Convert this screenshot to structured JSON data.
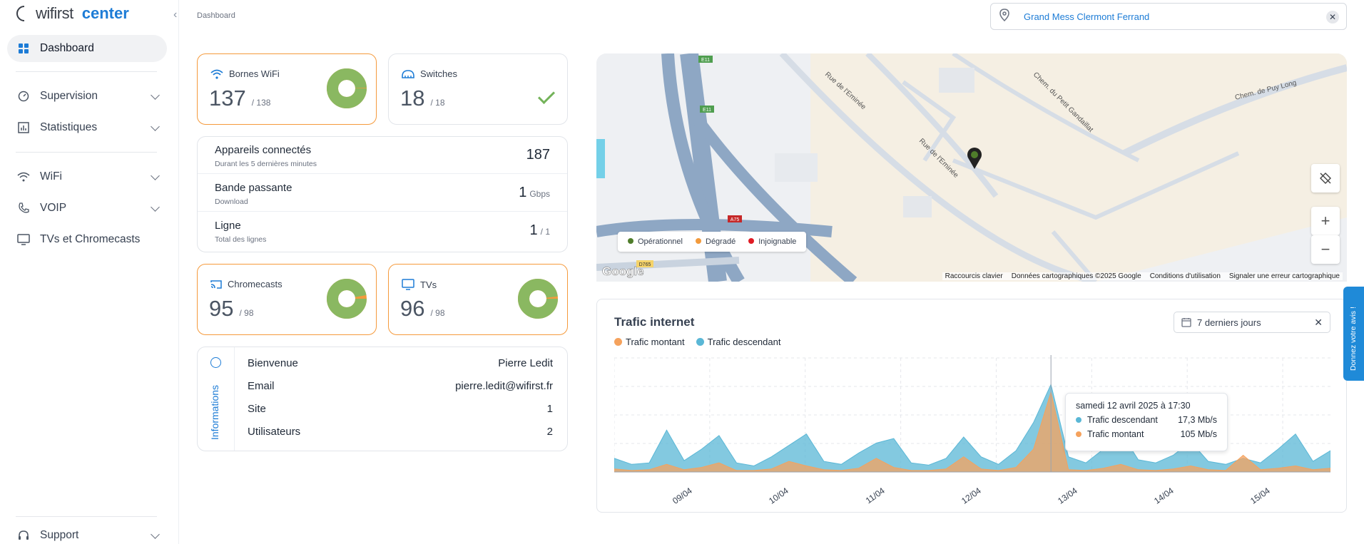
{
  "app": {
    "brand": "wifirst",
    "product": "center"
  },
  "breadcrumb": "Dashboard",
  "site": {
    "value": "Grand Mess Clermont Ferrand"
  },
  "sidebar": {
    "items": [
      {
        "label": "Dashboard",
        "icon": "grid-icon",
        "active": true
      },
      {
        "label": "Supervision",
        "icon": "gauge-icon"
      },
      {
        "label": "Statistiques",
        "icon": "chart-icon"
      },
      {
        "label": "WiFi",
        "icon": "wifi-icon"
      },
      {
        "label": "VOIP",
        "icon": "phone-icon"
      },
      {
        "label": "TVs et Chromecasts",
        "icon": "tv-icon"
      },
      {
        "label": "Support",
        "icon": "headset-icon"
      }
    ]
  },
  "cards": {
    "wifi": {
      "title": "Bornes WiFi",
      "value": "137",
      "total": "/ 138",
      "ratio": 0.993
    },
    "switches": {
      "title": "Switches",
      "value": "18",
      "total": "/ 18"
    },
    "chromecasts": {
      "title": "Chromecasts",
      "value": "95",
      "total": "/ 98",
      "ratio": 0.969
    },
    "tvs": {
      "title": "TVs",
      "value": "96",
      "total": "/ 98",
      "ratio": 0.98
    }
  },
  "stats": {
    "devices": {
      "label": "Appareils connectés",
      "desc": "Durant les 5 dernières minutes",
      "value": "187"
    },
    "bandwidth": {
      "label": "Bande passante",
      "desc": "Download",
      "value": "1",
      "unit": "Gbps"
    },
    "line": {
      "label": "Ligne",
      "desc": "Total des lignes",
      "value": "1",
      "unit": "/ 1"
    }
  },
  "info": {
    "title": "Informations",
    "rows": [
      {
        "label": "Bienvenue",
        "value": "Pierre Ledit"
      },
      {
        "label": "Email",
        "value": "pierre.ledit@wifirst.fr"
      },
      {
        "label": "Site",
        "value": "1"
      },
      {
        "label": "Utilisateurs",
        "value": "2"
      }
    ]
  },
  "map": {
    "streets": [
      "Rue de l'Eminée",
      "Chem. du Petit Gandaillat",
      "Chem. de Puy Long",
      "Rue de l'Eminée"
    ],
    "road_labels": [
      "E11",
      "E11",
      "A75",
      "D765"
    ],
    "legend": [
      {
        "label": "Opérationnel",
        "color": "#4f7d2b"
      },
      {
        "label": "Dégradé",
        "color": "#f29a3c"
      },
      {
        "label": "Injoignable",
        "color": "#e01b24"
      }
    ],
    "attribution": [
      "Raccourcis clavier",
      "Données cartographiques ©2025 Google",
      "Conditions d'utilisation",
      "Signaler une erreur cartographique"
    ],
    "google_logo": "Google"
  },
  "traffic": {
    "title": "Trafic internet",
    "range": "7 derniers jours",
    "legend": [
      {
        "label": "Trafic montant",
        "color": "#f5a25d"
      },
      {
        "label": "Trafic descendant",
        "color": "#5ab7d6"
      }
    ],
    "tooltip": {
      "date": "samedi 12 avril 2025 à 17:30",
      "rows": [
        {
          "label": "Trafic descendant",
          "value": "17,3 Mb/s",
          "color": "#5ab7d6"
        },
        {
          "label": "Trafic montant",
          "value": "105 Mb/s",
          "color": "#f5a25d"
        }
      ]
    }
  },
  "chart_data": {
    "type": "area",
    "categories": [
      "09/04",
      "10/04",
      "11/04",
      "12/04",
      "13/04",
      "14/04",
      "15/04"
    ],
    "series": [
      {
        "name": "Trafic descendant",
        "color": "#5ab7d6",
        "values": [
          18,
          10,
          12,
          55,
          15,
          30,
          48,
          12,
          8,
          20,
          35,
          50,
          14,
          10,
          25,
          38,
          44,
          12,
          9,
          18,
          46,
          20,
          10,
          28,
          65,
          115,
          20,
          12,
          30,
          52,
          16,
          12,
          22,
          40,
          14,
          10,
          18,
          12,
          30,
          50,
          14,
          28
        ]
      },
      {
        "name": "Trafic montant",
        "color": "#f5a25d",
        "values": [
          4,
          2,
          3,
          10,
          3,
          6,
          12,
          2,
          2,
          4,
          14,
          8,
          3,
          2,
          5,
          18,
          6,
          2,
          2,
          4,
          20,
          4,
          2,
          6,
          30,
          105,
          3,
          2,
          5,
          10,
          3,
          2,
          4,
          8,
          3,
          2,
          22,
          3,
          5,
          8,
          3,
          5
        ]
      }
    ],
    "ylim": [
      0,
      150
    ]
  },
  "feedback": "Donnez votre avis !"
}
